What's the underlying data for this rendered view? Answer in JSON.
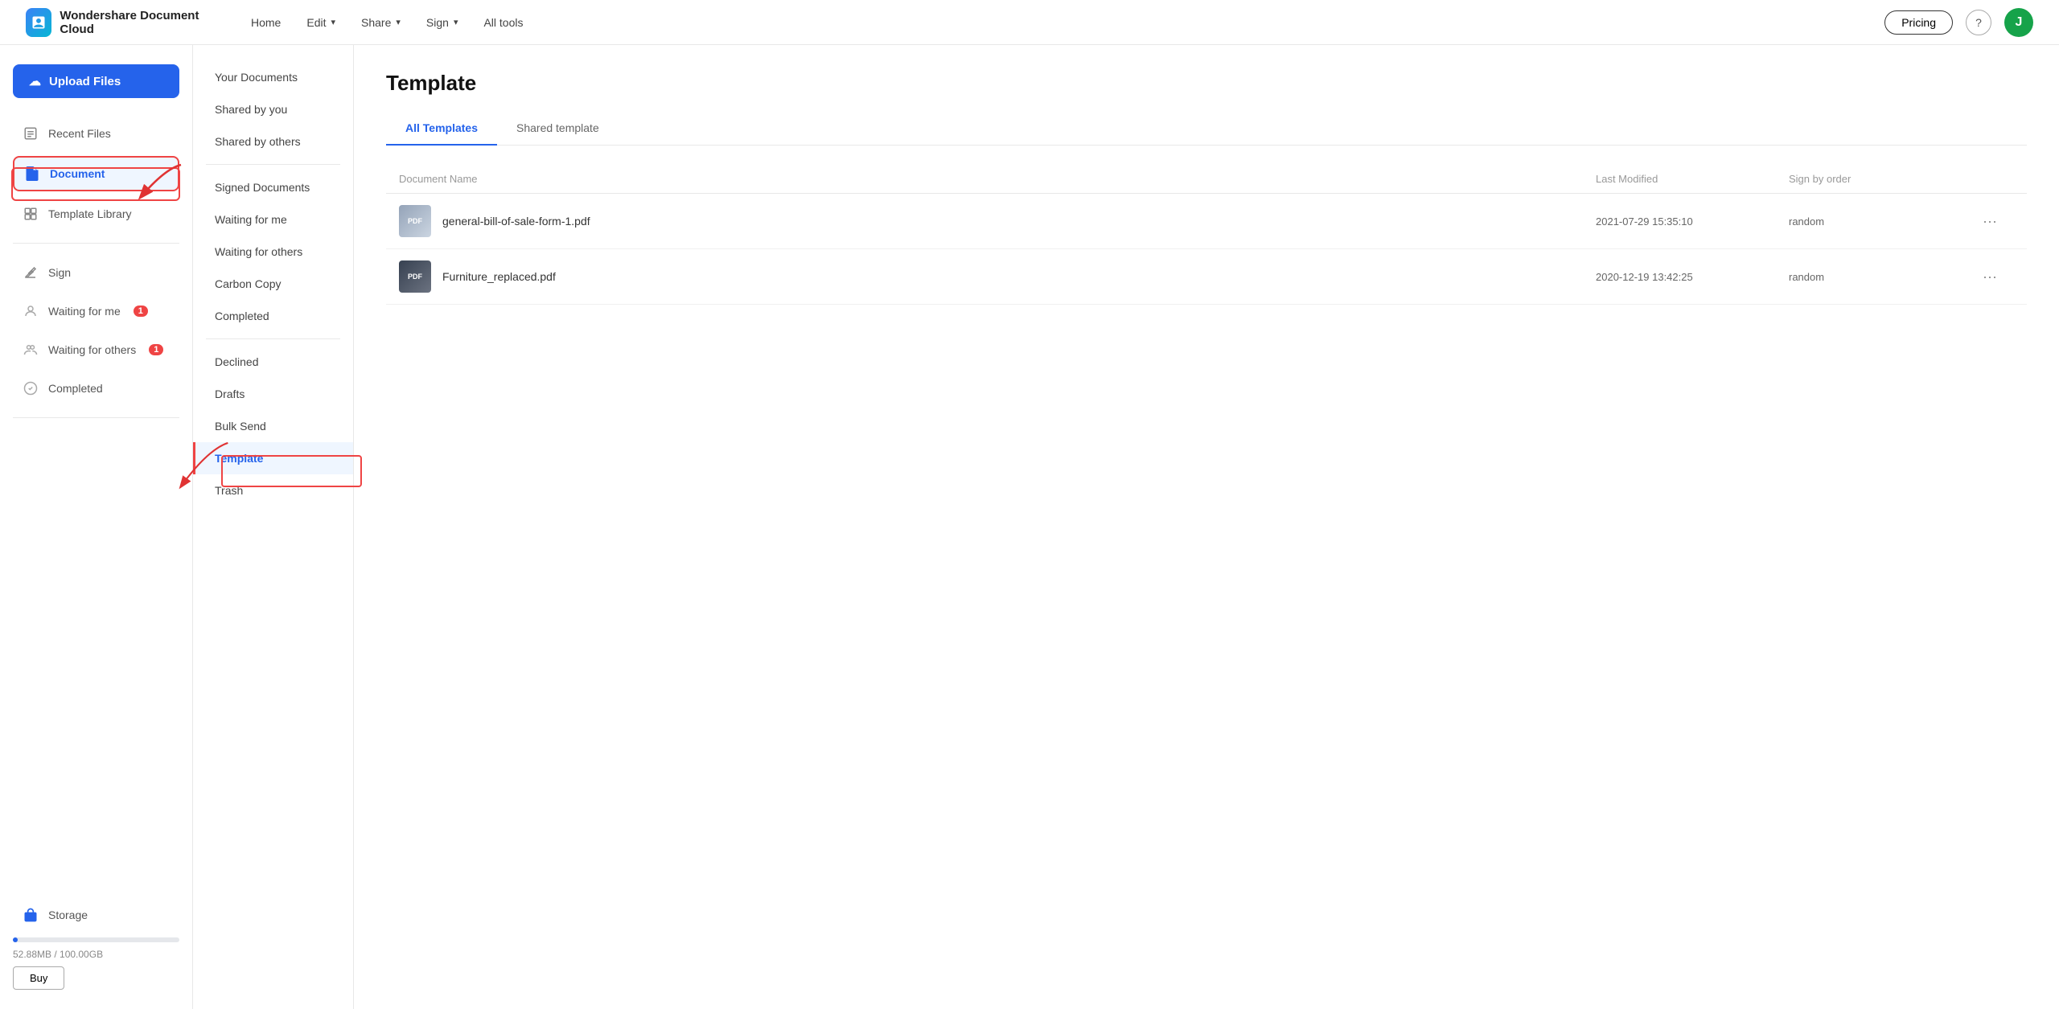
{
  "app": {
    "logo_text": "Wondershare Document Cloud",
    "nav": {
      "home": "Home",
      "edit": "Edit",
      "share": "Share",
      "sign": "Sign",
      "all_tools": "All tools",
      "pricing": "Pricing",
      "help": "?",
      "avatar_letter": "J"
    }
  },
  "left_sidebar": {
    "upload_button": "Upload Files",
    "items": [
      {
        "id": "recent-files",
        "label": "Recent Files",
        "icon": "recent"
      },
      {
        "id": "document",
        "label": "Document",
        "icon": "document",
        "active": true
      },
      {
        "id": "template-library",
        "label": "Template Library",
        "icon": "template-lib"
      }
    ],
    "sign_section": {
      "label": "Sign",
      "items": [
        {
          "id": "waiting-for-me",
          "label": "Waiting for me",
          "badge": "1"
        },
        {
          "id": "waiting-for-others",
          "label": "Waiting for others",
          "badge": "1"
        },
        {
          "id": "completed",
          "label": "Completed"
        }
      ]
    },
    "storage": {
      "label": "Storage",
      "used": "52.88MB",
      "total": "100.00GB",
      "usage_text": "52.88MB / 100.00GB",
      "buy_label": "Buy"
    }
  },
  "mid_sidebar": {
    "items": [
      {
        "id": "your-documents",
        "label": "Your Documents"
      },
      {
        "id": "shared-by-you",
        "label": "Shared by you"
      },
      {
        "id": "shared-by-others",
        "label": "Shared by others"
      },
      {
        "id": "signed-documents",
        "label": "Signed Documents"
      },
      {
        "id": "waiting-for-me",
        "label": "Waiting for me"
      },
      {
        "id": "waiting-for-others",
        "label": "Waiting for others"
      },
      {
        "id": "carbon-copy",
        "label": "Carbon Copy"
      },
      {
        "id": "completed",
        "label": "Completed"
      },
      {
        "id": "declined",
        "label": "Declined"
      },
      {
        "id": "drafts",
        "label": "Drafts"
      },
      {
        "id": "bulk-send",
        "label": "Bulk Send"
      },
      {
        "id": "template",
        "label": "Template",
        "active": true
      },
      {
        "id": "trash",
        "label": "Trash"
      }
    ]
  },
  "main": {
    "title": "Template",
    "tabs": [
      {
        "id": "all-templates",
        "label": "All Templates",
        "active": true
      },
      {
        "id": "shared-template",
        "label": "Shared template"
      }
    ],
    "table": {
      "headers": {
        "doc_name": "Document Name",
        "last_modified": "Last Modified",
        "sign_by_order": "Sign by order"
      },
      "rows": [
        {
          "id": "row-1",
          "name": "general-bill-of-sale-form-1.pdf",
          "last_modified": "2021-07-29 15:35:10",
          "sign_by_order": "random",
          "icon_type": "light"
        },
        {
          "id": "row-2",
          "name": "Furniture_replaced.pdf",
          "last_modified": "2020-12-19 13:42:25",
          "sign_by_order": "random",
          "icon_type": "dark"
        }
      ]
    }
  }
}
